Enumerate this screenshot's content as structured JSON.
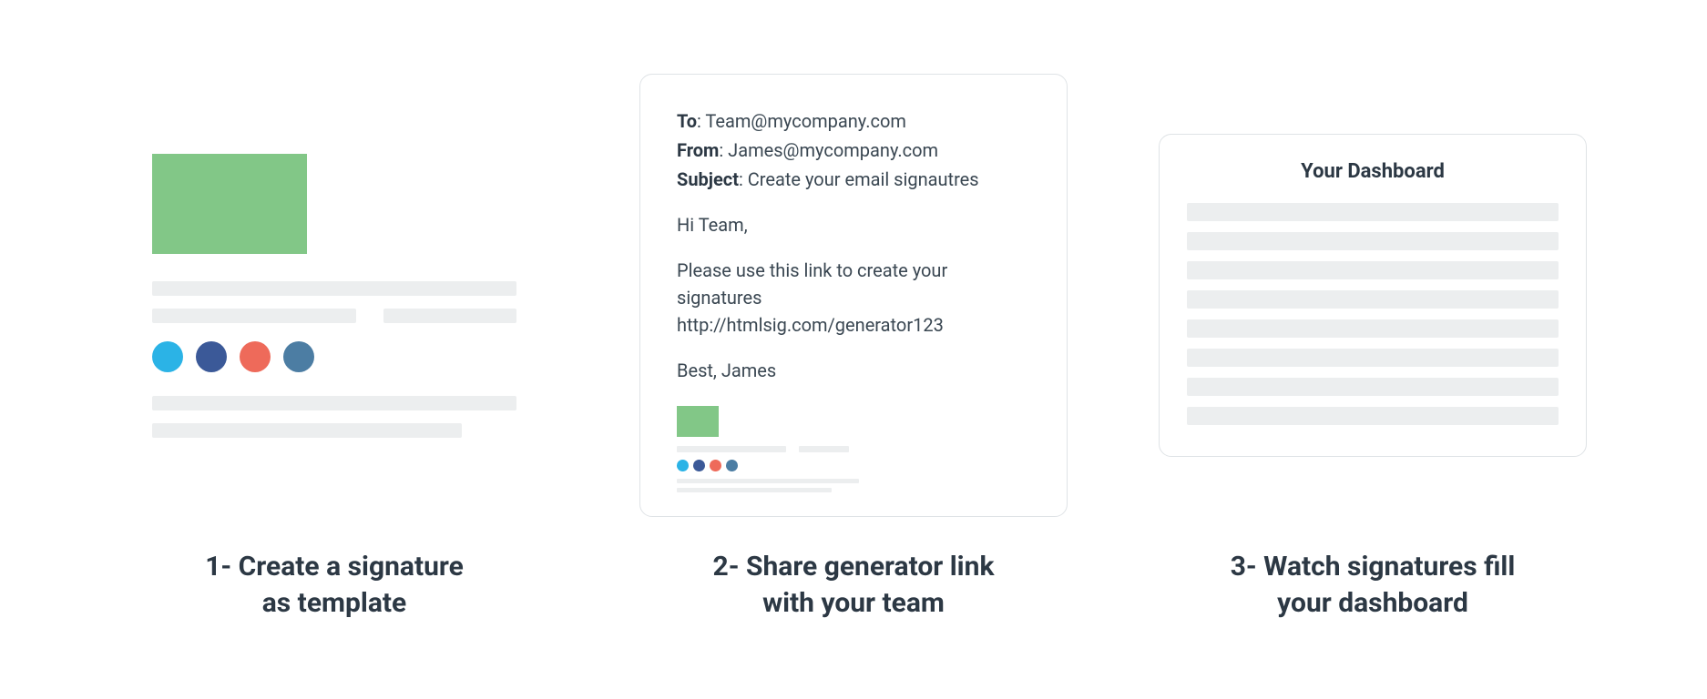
{
  "steps": {
    "one": {
      "caption": "1- Create a signature\nas template",
      "social_icons": [
        "twitter",
        "facebook",
        "google-plus",
        "linkedin"
      ]
    },
    "two": {
      "caption": "2- Share generator link\nwith your team",
      "to_label": "To",
      "to_value": ": Team@mycompany.com",
      "from_label": "From",
      "from_value": ": James@mycompany.com",
      "subject_label": "Subject",
      "subject_value": ": Create your email signautres",
      "greeting": "Hi Team,",
      "body_line1": "Please use this link to create your signatures",
      "body_link": "http://htmlsig.com/generator123",
      "signoff": "Best, James",
      "mini_social_icons": [
        "twitter",
        "facebook",
        "google-plus",
        "linkedin"
      ]
    },
    "three": {
      "caption": "3- Watch signatures fill\nyour dashboard",
      "dashboard_title": "Your Dashboard",
      "row_count": 8
    }
  },
  "colors": {
    "placeholder_green": "#82c787",
    "bar_grey": "#eceeef",
    "icon_twitter": "#2bb3e6",
    "icon_facebook": "#3b5998",
    "icon_red": "#ee6a5a",
    "icon_blue": "#4c7da3",
    "text": "#2c3844"
  }
}
